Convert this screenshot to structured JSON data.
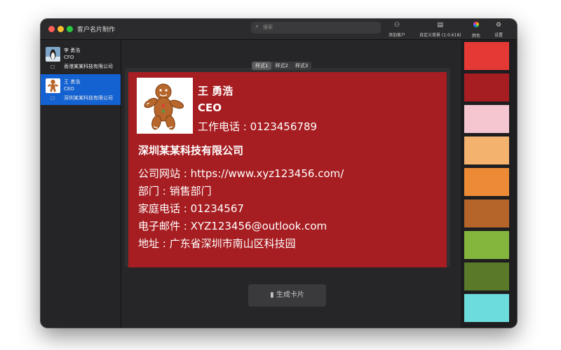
{
  "window": {
    "title": "客户名片制作"
  },
  "toolbar": {
    "search_placeholder": "搜索",
    "add_customer": "添加客户",
    "custom_bg": "自定义背景 (1:0.618)",
    "color": "颜色",
    "settings": "设置"
  },
  "contacts": [
    {
      "name": "李 勇浩",
      "title": "CFO",
      "company": "香港某某科技有限公司"
    },
    {
      "name": "王 勇浩",
      "title": "CEO",
      "company": "深圳某某科技有限公司"
    }
  ],
  "tabs": [
    "样式1",
    "样式2",
    "样式3"
  ],
  "card": {
    "name": "王 勇浩",
    "title": "CEO",
    "work_phone": "工作电话 : 0123456789",
    "company": "深圳某某科技有限公司",
    "website": "公司网站 : https://www.xyz123456.com/",
    "department": "部门 : 销售部门",
    "home_phone": "家庭电话 : 01234567",
    "email": "电子邮件 : XYZ123456@outlook.com",
    "address": "地址 : 广东省深圳市南山区科技园",
    "background_color": "#a71e22"
  },
  "generate_button": "生成卡片",
  "palette_colors": [
    "#e53935",
    "#a71e22",
    "#f5c6cf",
    "#f3b26d",
    "#ec8a35",
    "#b5652a",
    "#84b63d",
    "#5a7a2a",
    "#6ddcdc"
  ]
}
